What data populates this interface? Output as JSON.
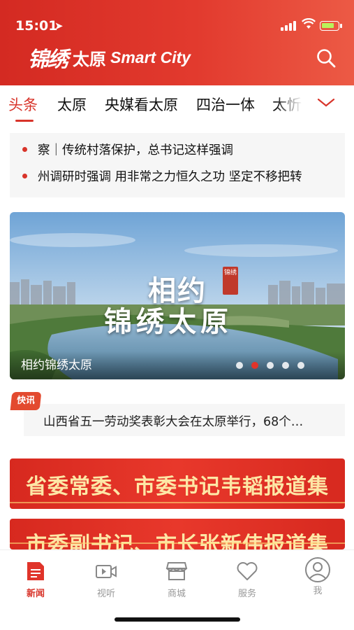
{
  "status_bar": {
    "time": "15:01",
    "location_icon": "location-arrow-icon",
    "signal_icon": "cellular-signal-icon",
    "wifi_icon": "wifi-icon",
    "battery_icon": "battery-charging-icon"
  },
  "header": {
    "logo_cn": "锦绣",
    "logo_city": "太原",
    "logo_en": "Smart City",
    "search_icon": "search-icon",
    "background_color": "#d42a22"
  },
  "tabs": {
    "items": [
      {
        "label": "头条",
        "active": true
      },
      {
        "label": "太原",
        "active": false
      },
      {
        "label": "央媒看太原",
        "active": false
      },
      {
        "label": "四治一体",
        "active": false
      },
      {
        "label": "太忻",
        "active": false
      }
    ],
    "more_icon": "chevron-down-icon",
    "accent_color": "#d8342a"
  },
  "ticker": {
    "items": [
      "察｜传统村落保护，总书记这样强调",
      "州调研时强调 用非常之力恒久之功 坚定不移把转"
    ]
  },
  "banner": {
    "title_line1": "相约",
    "title_line2": "锦绣太原",
    "seal_text": "锦绣",
    "caption": "相约锦绣太原",
    "page_count": 5,
    "active_index": 1
  },
  "flash": {
    "tag": "快讯",
    "text": "山西省五一劳动奖表彰大会在太原举行，68个…"
  },
  "promos": [
    {
      "text": "省委常委、市委书记韦韬报道集"
    },
    {
      "text": "市委副书记、市长张新伟报道集"
    }
  ],
  "tabbar": {
    "items": [
      {
        "label": "新闻",
        "icon": "news-icon",
        "active": true
      },
      {
        "label": "视听",
        "icon": "video-icon",
        "active": false
      },
      {
        "label": "商城",
        "icon": "store-icon",
        "active": false
      },
      {
        "label": "服务",
        "icon": "heart-icon",
        "active": false
      },
      {
        "label": "我",
        "icon": "user-icon",
        "active": false
      }
    ]
  }
}
